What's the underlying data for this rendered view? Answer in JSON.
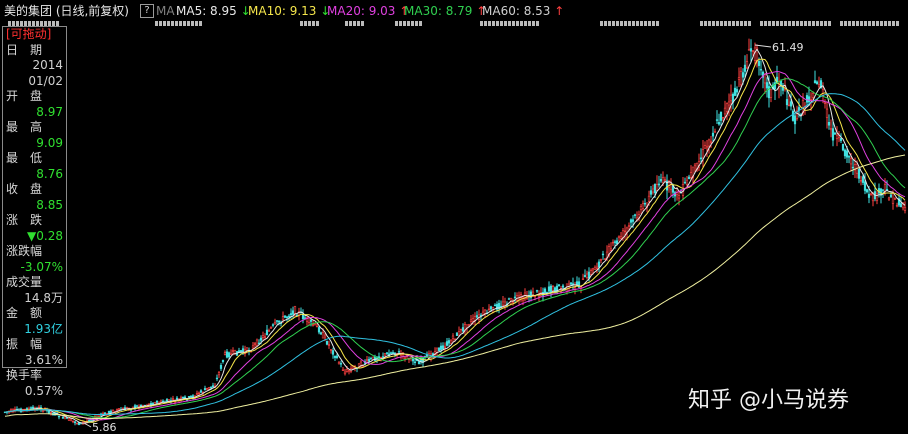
{
  "header": {
    "title": "美的集团 (日线,前复权)",
    "help_icon": "?",
    "ma_label": "MA",
    "ma5": {
      "label": "MA5: 8.95",
      "arrow": "↓",
      "color": "#e8e8e8"
    },
    "ma10": {
      "label": "MA10: 9.13",
      "arrow": "↓",
      "color": "#f5e64b"
    },
    "ma20": {
      "label": "MA20: 9.03",
      "arrow": "↑",
      "color": "#e040e0"
    },
    "ma30": {
      "label": "MA30: 8.79",
      "arrow": "↑",
      "color": "#30d050"
    },
    "ma60": {
      "label": "MA60: 8.53",
      "arrow": "↑",
      "color": "#d0d0d0"
    }
  },
  "info_panel": {
    "draggable_tag": "[可拖动]",
    "rows": [
      {
        "label": "日　期",
        "value": "2014",
        "value2": "01/02",
        "color": "#d0d0d0"
      },
      {
        "label": "开　盘",
        "value": "8.97",
        "color": "#30e030"
      },
      {
        "label": "最　高",
        "value": "9.09",
        "color": "#30e030"
      },
      {
        "label": "最　低",
        "value": "8.76",
        "color": "#30e030"
      },
      {
        "label": "收　盘",
        "value": "8.85",
        "color": "#30e030"
      },
      {
        "label": "涨　跌",
        "value": "▼0.28",
        "color": "#30e030"
      },
      {
        "label": "涨跌幅",
        "value": "-3.07%",
        "color": "#30e030"
      },
      {
        "label": "成交量",
        "value": "14.8万",
        "color": "#d0d0d0"
      },
      {
        "label": "金　额",
        "value": "1.93亿",
        "color": "#30d0e0"
      },
      {
        "label": "振　幅",
        "value": "3.61%",
        "color": "#d0d0d0"
      },
      {
        "label": "换手率",
        "value": "0.57%",
        "color": "#d0d0d0"
      }
    ]
  },
  "price_marks": {
    "high": "61.49",
    "low": "5.86"
  },
  "watermark": "知乎 @小马说券",
  "colors": {
    "up": "#ff4040",
    "down": "#40e0e0",
    "bg": "#000000"
  }
}
